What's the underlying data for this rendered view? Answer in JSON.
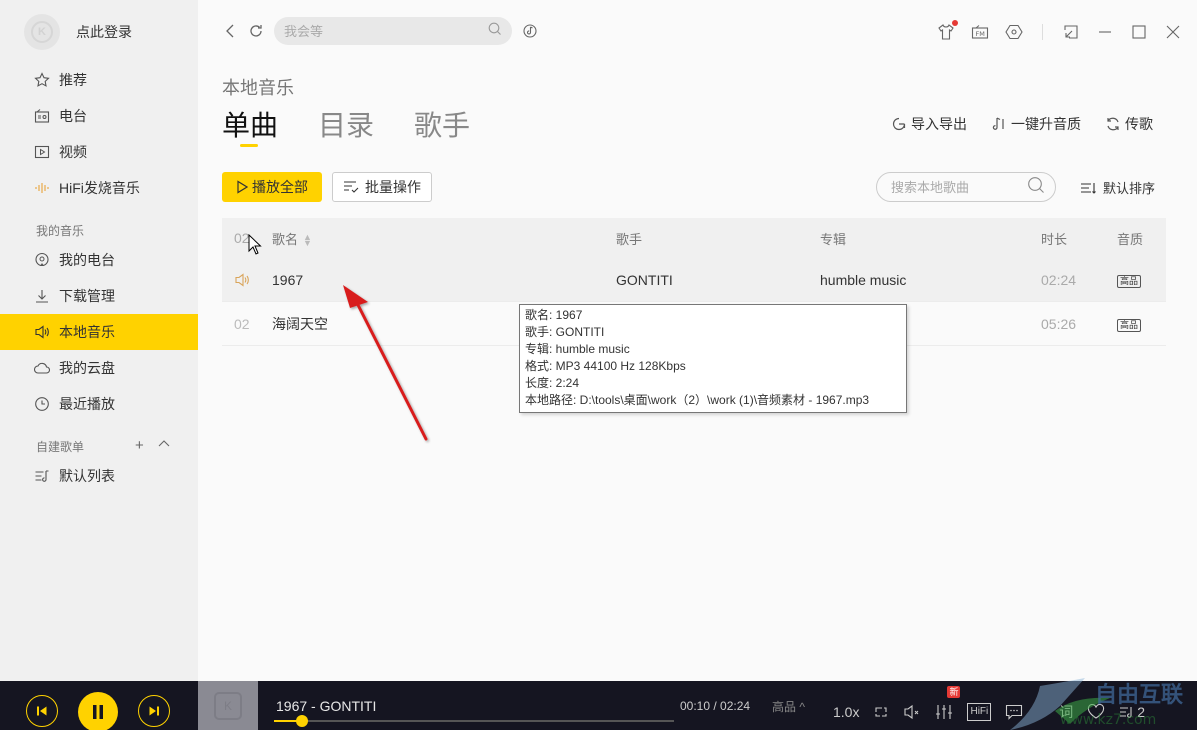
{
  "sidebar": {
    "login_label": "点此登录",
    "items": [
      {
        "label": "推荐",
        "icon": "star-icon"
      },
      {
        "label": "电台",
        "icon": "radio-icon"
      },
      {
        "label": "视频",
        "icon": "video-icon"
      },
      {
        "label": "HiFi发烧音乐",
        "icon": "hifi-wave-icon"
      }
    ],
    "my_music_label": "我的音乐",
    "my_music_items": [
      {
        "label": "我的电台",
        "icon": "podcast-icon"
      },
      {
        "label": "下载管理",
        "icon": "download-icon"
      },
      {
        "label": "本地音乐",
        "icon": "speaker-icon",
        "active": true
      },
      {
        "label": "我的云盘",
        "icon": "cloud-icon"
      },
      {
        "label": "最近播放",
        "icon": "clock-icon"
      }
    ],
    "playlist_section_label": "自建歌单",
    "playlist_add": "+",
    "playlist_collapse": "^",
    "playlists": [
      {
        "label": "默认列表",
        "icon": "playlist-icon"
      }
    ]
  },
  "topbar": {
    "search_placeholder": "我会等"
  },
  "main": {
    "subtitle": "本地音乐",
    "tabs": [
      {
        "label": "单曲",
        "active": true
      },
      {
        "label": "目录",
        "active": false
      },
      {
        "label": "歌手",
        "active": false
      }
    ],
    "actions": {
      "import_export": "导入导出",
      "upgrade_quality": "一键升音质",
      "transfer": "传歌"
    },
    "toolbar": {
      "play_all": "播放全部",
      "batch": "批量操作",
      "search_placeholder": "搜索本地歌曲",
      "sort": "默认排序"
    },
    "table": {
      "headers": {
        "index": "02",
        "name": "歌名",
        "artist": "歌手",
        "album": "专辑",
        "duration": "时长",
        "quality": "音质"
      },
      "rows": [
        {
          "index": "",
          "name": "1967",
          "artist": "GONTITI",
          "album": "humble music",
          "duration": "02:24",
          "quality": "高品",
          "playing": true
        },
        {
          "index": "02",
          "name": "海阔天空",
          "artist": "",
          "album": "",
          "duration": "05:26",
          "quality": "高品",
          "playing": false
        }
      ]
    },
    "tooltip": {
      "lines": [
        "歌名:  1967",
        "歌手:  GONTITI",
        "专辑:  humble music",
        "格式:  MP3   44100 Hz   128Kbps",
        "长度:  2:24",
        "本地路径:  D:\\tools\\桌面\\work（2）\\work (1)\\音频素材 - 1967.mp3"
      ]
    }
  },
  "player": {
    "now_playing": "1967 - GONTITI",
    "current_time": "00:10",
    "total_time": "02:24",
    "time_display": "00:10 / 02:24",
    "progress": 0.069,
    "quality": "高品 ^",
    "speed": "1.0x",
    "new_badge": "新",
    "hifi_label": "HiFi",
    "lyrics_label": "词",
    "queue_count": "2",
    "accent": "#ffd200"
  },
  "colors": {
    "accent": "#ffd200",
    "player_bg": "#151521",
    "annotation_arrow": "#d81e1e"
  }
}
